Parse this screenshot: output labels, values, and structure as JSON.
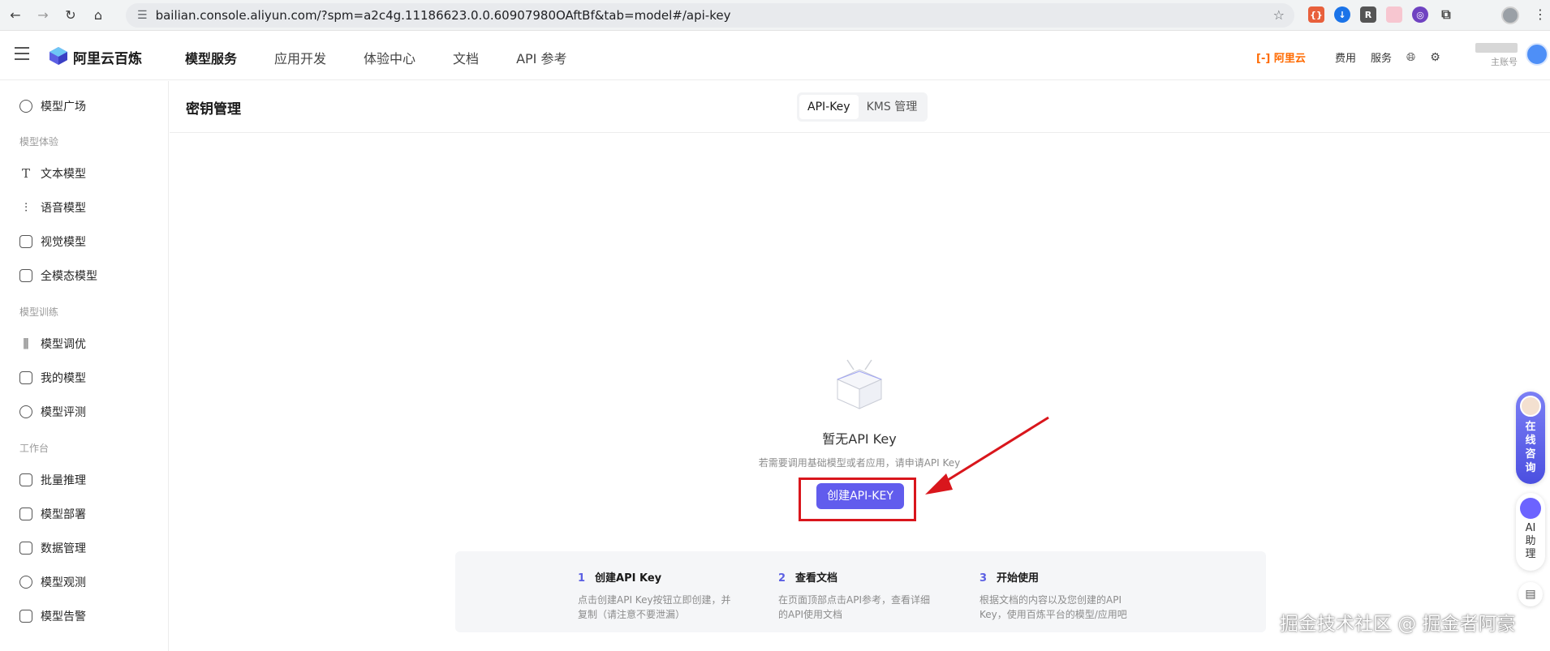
{
  "browser": {
    "url": "bailian.console.aliyun.com/?spm=a2c4g.11186623.0.0.60907980OAftBf&tab=model#/api-key"
  },
  "header": {
    "brand": "阿里云百炼",
    "nav": [
      "模型服务",
      "应用开发",
      "体验中心",
      "文档",
      "API 参考"
    ],
    "aliyun": "阿里云",
    "billing": "费用",
    "service": "服务",
    "account_sub": "主账号"
  },
  "sidebar": {
    "items_top": [
      {
        "label": "模型广场"
      }
    ],
    "group1": "模型体验",
    "group1_items": [
      {
        "label": "文本模型"
      },
      {
        "label": "语音模型"
      },
      {
        "label": "视觉模型"
      },
      {
        "label": "全模态模型"
      }
    ],
    "group2": "模型训练",
    "group2_items": [
      {
        "label": "模型调优"
      },
      {
        "label": "我的模型"
      },
      {
        "label": "模型评测"
      }
    ],
    "group3": "工作台",
    "group3_items": [
      {
        "label": "批量推理"
      },
      {
        "label": "模型部署"
      },
      {
        "label": "数据管理"
      },
      {
        "label": "模型观测"
      },
      {
        "label": "模型告警"
      }
    ]
  },
  "page": {
    "title": "密钥管理",
    "tabs": [
      "API-Key",
      "KMS 管理"
    ]
  },
  "empty": {
    "title": "暂无API Key",
    "subtitle": "若需要调用基础模型或者应用，请申请API Key",
    "button": "创建API-KEY"
  },
  "steps": [
    {
      "num": "1",
      "title": "创建API Key",
      "line1": "点击创建API Key按钮立即创建，并",
      "line2": "复制（请注意不要泄漏）"
    },
    {
      "num": "2",
      "title": "查看文档",
      "line1": "在页面顶部点击API参考，查看详细",
      "line2": "的API使用文档"
    },
    {
      "num": "3",
      "title": "开始使用",
      "line1": "根据文档的内容以及您创建的API",
      "line2": "Key，使用百炼平台的模型/应用吧"
    }
  ],
  "float": {
    "consult": [
      "在",
      "线",
      "咨",
      "询"
    ],
    "ai": [
      "AI",
      "助",
      "理"
    ]
  },
  "watermark": "掘金技术社区 @ 掘金者阿豪",
  "colors": {
    "primary": "#615ced",
    "highlight": "#d9161c",
    "brand_orange": "#ff6a00"
  }
}
